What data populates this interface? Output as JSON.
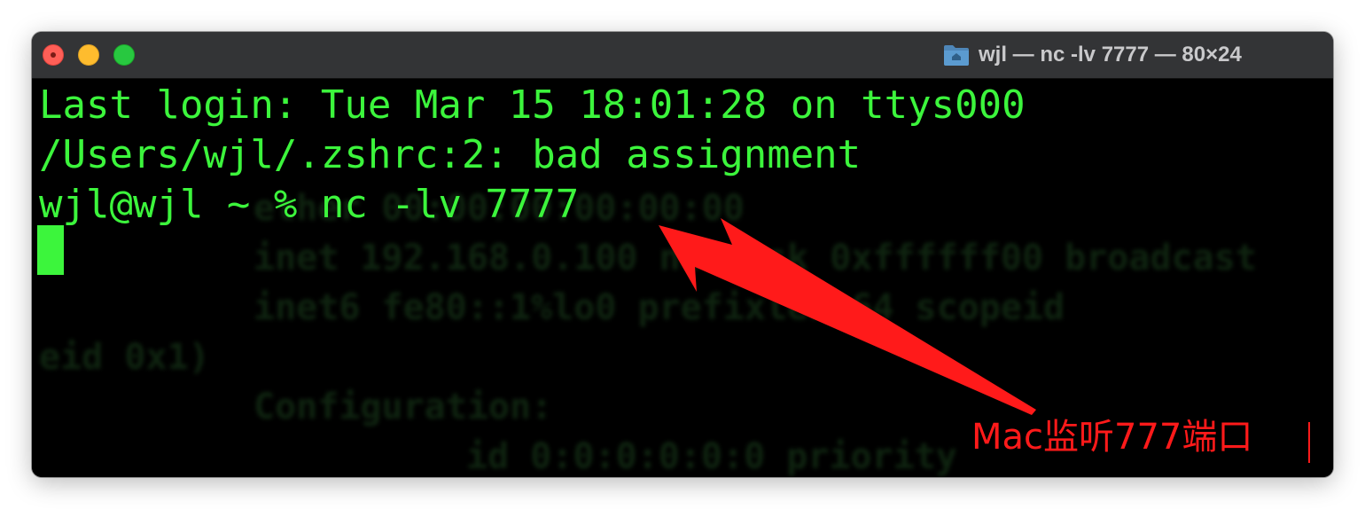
{
  "window": {
    "title": "wjl — nc -lv 7777 — 80×24",
    "title_icon": "folder-home-icon",
    "traffic_lights": {
      "close_color": "#ff5f57",
      "minimize_color": "#febc2e",
      "maximize_color": "#28c840"
    }
  },
  "terminal": {
    "text_color": "#3cf53c",
    "background": "#000000",
    "lines": [
      "Last login: Tue Mar 15 18:01:28 on ttys000",
      "/Users/wjl/.zshrc:2: bad assignment",
      "wjl@wjl ~ % nc -lv 7777"
    ]
  },
  "annotation": {
    "label": "Mac监听777端口",
    "color": "#ff1a1a",
    "icon": "red-arrow-icon"
  }
}
